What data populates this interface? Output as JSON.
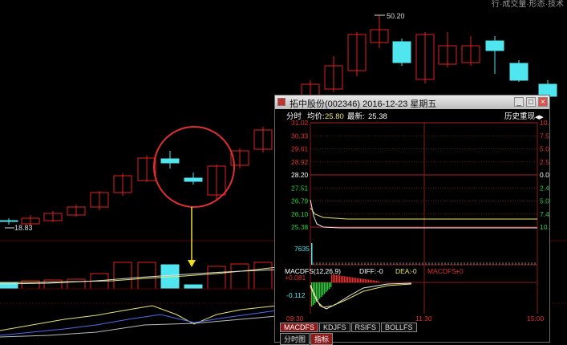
{
  "background_chart": {
    "price_high_label": "50.20",
    "price_low_label": "18.83",
    "corner_text": "行·成交量·形态·技术"
  },
  "popup": {
    "title": "拓中股份(002346)  2016-12-23  星期五",
    "buttons": {
      "minimize": "_",
      "maximize": "□",
      "close": "×"
    },
    "header": {
      "mode": "分时",
      "avg_label": "均价:",
      "avg_value": "25.80",
      "latest_label": "最新:",
      "latest_value": "25.38",
      "history": "历史重现",
      "history_icon": "◀▶"
    },
    "left_axis": [
      "31.02",
      "30.33",
      "29.61",
      "28.92",
      "28.20",
      "27.51",
      "26.79",
      "26.10",
      "25.38"
    ],
    "right_axis": [
      "10.00%",
      "7.55%",
      "5.03%",
      "2.55%",
      "0.00%",
      "2.45%",
      "5.03%",
      "7.45%",
      "10.00%"
    ],
    "volume_label": "7635",
    "indicator": {
      "name": "MACDFS(12,26,9)",
      "diff_label": "DIFF:",
      "diff_value": "-0",
      "dea_label": "DEA:",
      "dea_value": "-0",
      "macdfs_label": "MACDFS:",
      "macdfs_value": "+0",
      "upper_value": "+0.081",
      "lower_value": "-0.112"
    },
    "time_axis": [
      "09:30",
      "11:30",
      "15:00"
    ],
    "tabs": [
      "MACDFS",
      "KDJFS",
      "RSIFS",
      "BOLLFS"
    ],
    "tabs2": [
      "分时图",
      "指标"
    ]
  },
  "colors": {
    "up": "#e02020",
    "down": "#4fe6f0",
    "ma_yellow": "#e8e36a"
  }
}
